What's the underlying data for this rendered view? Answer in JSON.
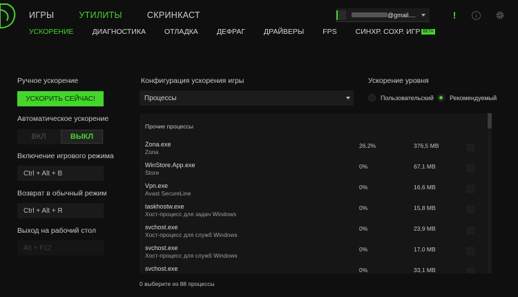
{
  "header": {
    "logo": "razer-logo-icon",
    "top_tabs": [
      {
        "label": "ИГРЫ",
        "active": false
      },
      {
        "label": "УТИЛИТЫ",
        "active": true
      },
      {
        "label": "СКРИНКАСТ",
        "active": false
      }
    ],
    "sub_tabs": [
      {
        "label": "УСКОРЕНИЕ",
        "active": true
      },
      {
        "label": "ДИАГНОСТИКА",
        "active": false
      },
      {
        "label": "ОТЛАДКА",
        "active": false
      },
      {
        "label": "ДЕФРАГ",
        "active": false
      },
      {
        "label": "ДРАЙВЕРЫ",
        "active": false
      },
      {
        "label": "FPS",
        "active": false
      },
      {
        "label": "СИНХР. СОХР. ИГР",
        "active": false,
        "badge": "BETA"
      }
    ],
    "account_email_suffix": "@gmail....",
    "icons": [
      "alert-icon",
      "info-icon",
      "gear-icon"
    ]
  },
  "left": {
    "manual_label": "Ручное ускорение",
    "boost_button": "УСКОРИТЬ СЕЙЧАС!",
    "auto_label": "Автоматическое ускорение",
    "toggle_on": "ВКЛ",
    "toggle_off": "ВЫКЛ",
    "game_mode_label": "Включение игрового режима",
    "game_mode_hotkey": "Ctrl + Alt + B",
    "normal_mode_label": "Возврат в обычный режим",
    "normal_mode_hotkey": "Ctrl + Alt + R",
    "desktop_label": "Выход на рабочий стол",
    "desktop_hotkey": "Alt + F12"
  },
  "config": {
    "title": "Конфигурация ускорения игры",
    "select_value": "Процессы",
    "level_title": "Ускорение уровня",
    "radio_custom": "Пользовательский",
    "radio_recommended": "Рекомендуемый",
    "selected": "recommended"
  },
  "processes": {
    "group_label": "Прочие процессы",
    "rows": [
      {
        "name": "Zona.exe",
        "desc": "Zona",
        "cpu": "26.2%",
        "mem": "376,5 MB"
      },
      {
        "name": "WinStore.App.exe",
        "desc": "Store",
        "cpu": "0%",
        "mem": "67,1 MB"
      },
      {
        "name": "Vpn.exe",
        "desc": "Avast SecureLine",
        "cpu": "0%",
        "mem": "16,6 MB"
      },
      {
        "name": "taskhostw.exe",
        "desc": "Хост-процесс для задач Windows",
        "cpu": "0%",
        "mem": "15,8 MB"
      },
      {
        "name": "svchost.exe",
        "desc": "Хост-процесс для служб Windows",
        "cpu": "0%",
        "mem": "23,9 MB"
      },
      {
        "name": "svchost.exe",
        "desc": "Хост-процесс для служб Windows",
        "cpu": "0%",
        "mem": "17,0 MB"
      },
      {
        "name": "svchost.exe",
        "desc": "",
        "cpu": "0%",
        "mem": "33,1 MB"
      }
    ],
    "footer": "0 выберите из 88 процессы"
  },
  "colors": {
    "accent": "#44d62c",
    "background": "#0f0f0f",
    "panel": "#161616"
  }
}
